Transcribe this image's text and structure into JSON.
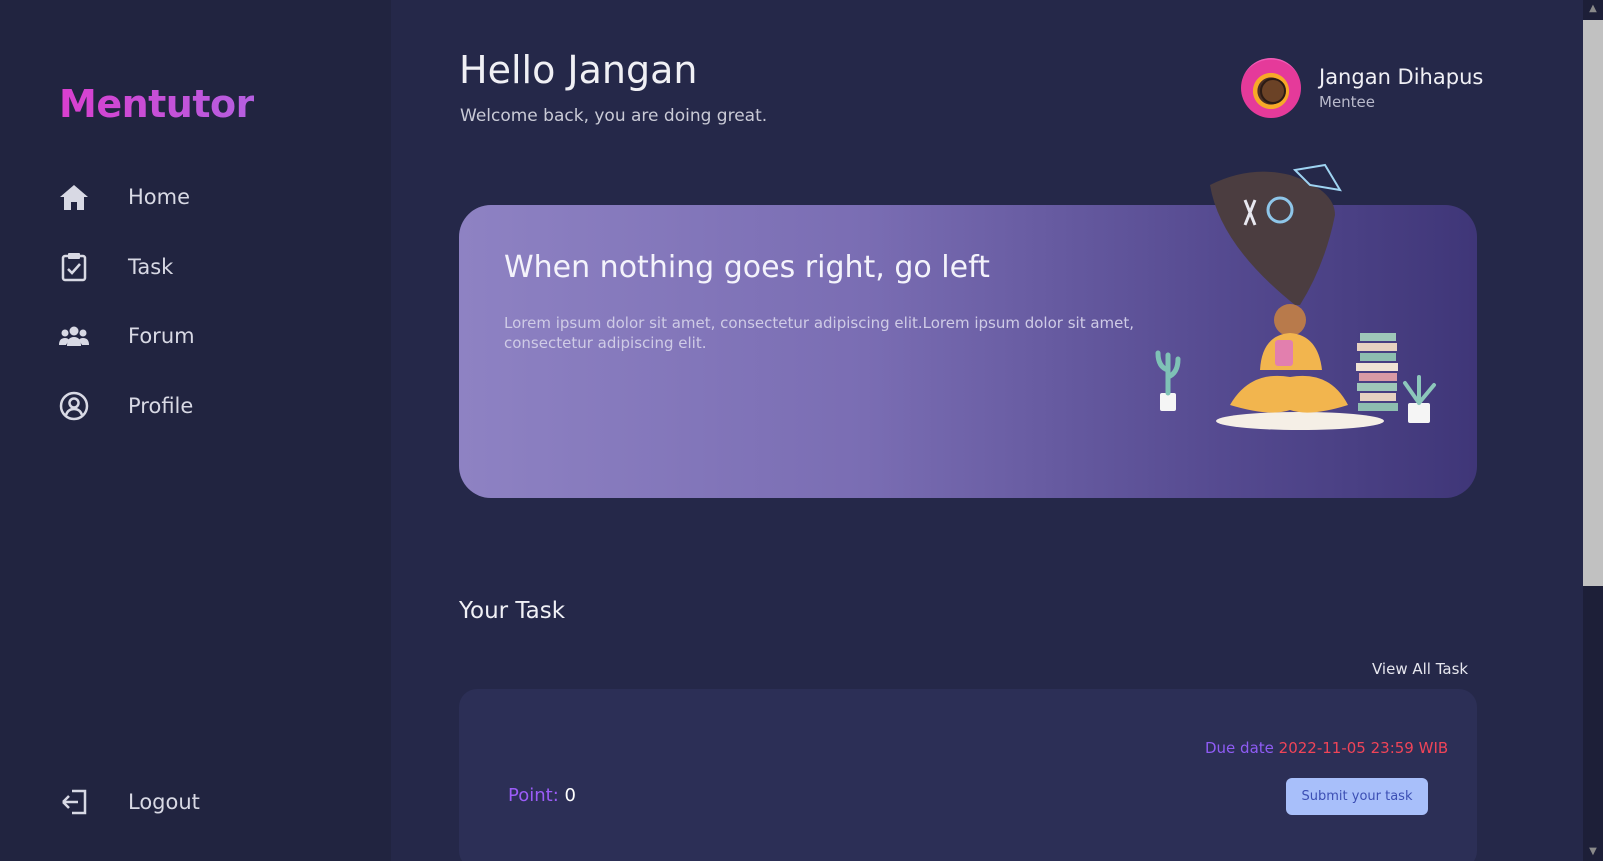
{
  "sidebar": {
    "brand": "Mentutor",
    "items": [
      {
        "label": "Home",
        "icon": "home-icon"
      },
      {
        "label": "Task",
        "icon": "task-clipboard-icon"
      },
      {
        "label": "Forum",
        "icon": "users-icon"
      },
      {
        "label": "Profile",
        "icon": "user-circle-icon"
      }
    ],
    "logout": {
      "label": "Logout",
      "icon": "logout-icon"
    }
  },
  "header": {
    "greeting": "Hello Jangan",
    "subtitle": "Welcome back, you are doing great."
  },
  "profile": {
    "name": "Jangan Dihapus",
    "role": "Mentee"
  },
  "banner": {
    "title": "When nothing goes right, go left",
    "text": "Lorem ipsum dolor sit amet, consectetur adipiscing elit.Lorem ipsum dolor sit amet, consectetur adipiscing elit."
  },
  "tasks": {
    "section_title": "Your Task",
    "view_all_label": "View All Task",
    "card": {
      "due_label": "Due date",
      "due_value": "2022-11-05 23:59 WIB",
      "point_label": "Point:",
      "point_value": "0",
      "submit_label": "Submit your task"
    }
  },
  "colors": {
    "brand_gradient_start": "#d93fcf",
    "brand_gradient_end": "#b55fe0",
    "due_value": "#f04458",
    "point_label": "#9b5cf7",
    "submit_bg": "#a8bffa"
  }
}
